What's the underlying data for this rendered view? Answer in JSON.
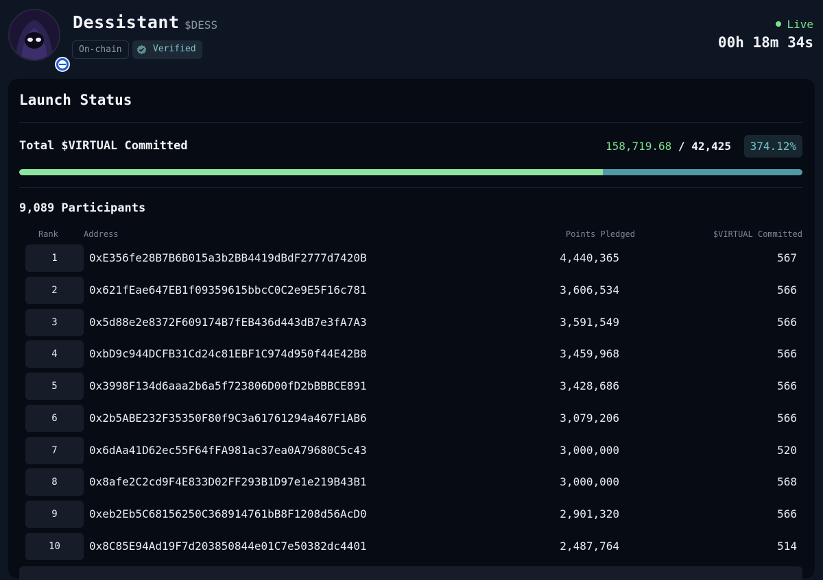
{
  "token": {
    "name": "Dessistant",
    "ticker": "$DESS",
    "tags": {
      "onchain": "On-chain",
      "verified": "Verified"
    },
    "status": "Live",
    "timer": "00h 18m 34s"
  },
  "launch": {
    "title": "Launch Status",
    "total_label": "Total $VIRTUAL Committed",
    "committed": "158,719.68",
    "separator": "/",
    "target": "42,425",
    "percent": "374.12%",
    "progress_fraction": 0.745,
    "participants_label": "9,089 Participants"
  },
  "table": {
    "headers": {
      "rank": "Rank",
      "address": "Address",
      "points": "Points Pledged",
      "committed": "$VIRTUAL Committed"
    },
    "rows": [
      {
        "rank": "1",
        "address": "0xE356fe28B7B6B015a3b2BB4419dBdF2777d7420B",
        "points": "4,440,365",
        "committed": "567"
      },
      {
        "rank": "2",
        "address": "0x621fEae647EB1f09359615bbcC0C2e9E5F16c781",
        "points": "3,606,534",
        "committed": "566"
      },
      {
        "rank": "3",
        "address": "0x5d88e2e8372F609174B7fEB436d443dB7e3fA7A3",
        "points": "3,591,549",
        "committed": "566"
      },
      {
        "rank": "4",
        "address": "0xbD9c944DCFB31Cd24c81EBF1C974d950f44E42B8",
        "points": "3,459,968",
        "committed": "566"
      },
      {
        "rank": "5",
        "address": "0x3998F134d6aaa2b6a5f723806D00fD2bBBBCE891",
        "points": "3,428,686",
        "committed": "566"
      },
      {
        "rank": "6",
        "address": "0x2b5ABE232F35350F80f9C3a61761294a467F1AB6",
        "points": "3,079,206",
        "committed": "566"
      },
      {
        "rank": "7",
        "address": "0x6dAa41D62ec55F64fFA981ac37ea0A79680C5c43",
        "points": "3,000,000",
        "committed": "520"
      },
      {
        "rank": "8",
        "address": "0x8afe2C2cd9F4E833D02FF293B1D97e1e219B43B1",
        "points": "3,000,000",
        "committed": "568"
      },
      {
        "rank": "9",
        "address": "0xeb2Eb5C68156250C368914761bB8F1208d56AcD0",
        "points": "2,901,320",
        "committed": "566"
      },
      {
        "rank": "10",
        "address": "0x8C85E94Ad19F7d203850844e01C7e50382dc4401",
        "points": "2,487,764",
        "committed": "514"
      }
    ]
  },
  "icons": {
    "avatar": "hooded-figure-avatar-icon",
    "chain": "base-chain-icon",
    "verified": "check-shield-icon",
    "live": "live-dot-icon"
  },
  "colors": {
    "background": "#0f1623",
    "card": "#070b13",
    "accent_green": "#7ee08e",
    "accent_teal": "#6fc5cf"
  }
}
